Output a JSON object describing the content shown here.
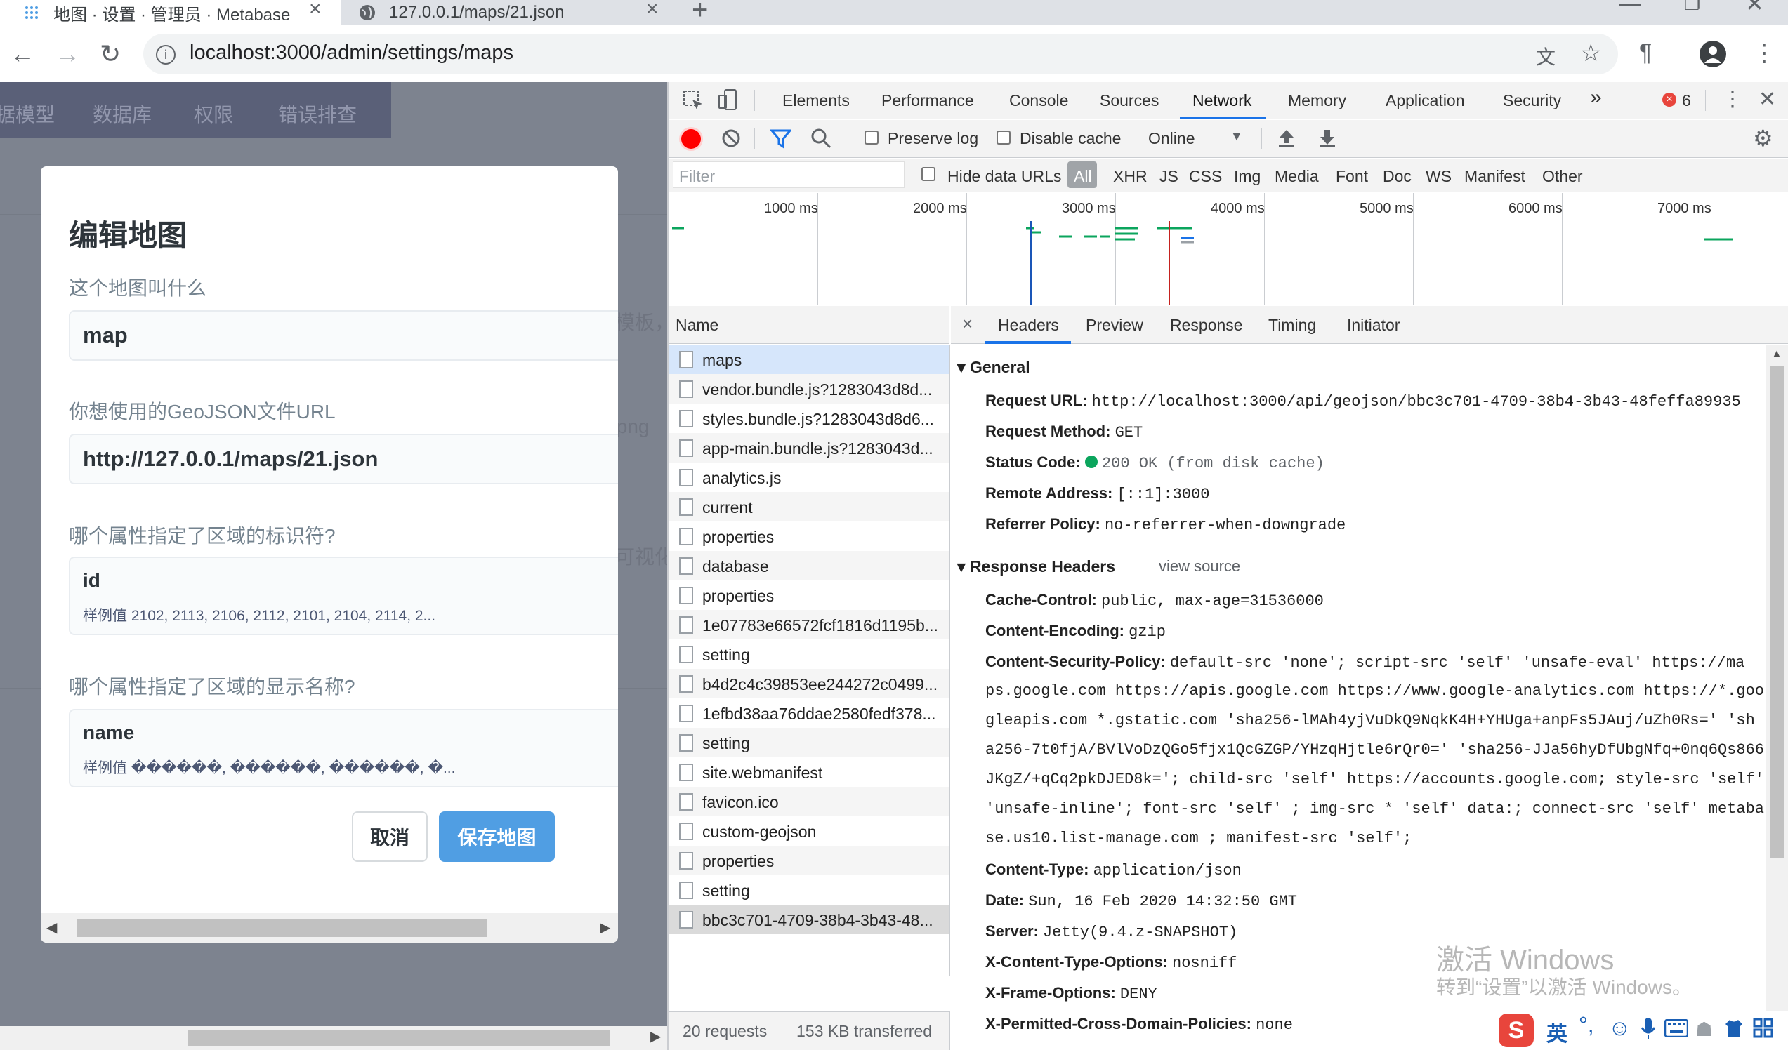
{
  "browser": {
    "tabs": [
      {
        "title": "地图 · 设置 · 管理员 · Metabase",
        "icon": "metabase-icon",
        "active": true
      },
      {
        "title": "127.0.0.1/maps/21.json",
        "icon": "globe-icon",
        "active": false
      }
    ],
    "new_tab": "+",
    "url": "localhost:3000/admin/settings/maps"
  },
  "page": {
    "nav": [
      "据模型",
      "数据库",
      "权限",
      "错误排查"
    ],
    "bg_fragments": [
      "模板，",
      ".png",
      "可视化"
    ]
  },
  "modal": {
    "title": "编辑地图",
    "name_label": "这个地图叫什么",
    "name_value": "map",
    "url_label": "你想使用的GeoJSON文件URL",
    "url_value": "http://127.0.0.1/maps/21.json",
    "region_id_label": "哪个属性指定了区域的标识符?",
    "region_id_value": "id",
    "region_id_sample": "样例值 2102, 2113, 2106, 2112, 2101, 2104, 2114, 2...",
    "region_name_label": "哪个属性指定了区域的显示名称?",
    "region_name_value": "name",
    "region_name_sample": "样例值 ������, ������, ������, �...",
    "cancel": "取消",
    "save": "保存地图"
  },
  "devtools": {
    "tabs": [
      "Elements",
      "Performance",
      "Console",
      "Sources",
      "Network",
      "Memory",
      "Application",
      "Security"
    ],
    "more": "»",
    "error_count": "6",
    "preserve_log": "Preserve log",
    "disable_cache": "Disable cache",
    "throttle": "Online",
    "filter_placeholder": "Filter",
    "hide_data_urls": "Hide data URLs",
    "filter_types": [
      "All",
      "XHR",
      "JS",
      "CSS",
      "Img",
      "Media",
      "Font",
      "Doc",
      "WS",
      "Manifest",
      "Other"
    ],
    "timeline_ticks": [
      "1000 ms",
      "2000 ms",
      "3000 ms",
      "4000 ms",
      "5000 ms",
      "6000 ms",
      "7000 ms"
    ],
    "name_header": "Name",
    "requests": [
      "maps",
      "vendor.bundle.js?1283043d8d...",
      "styles.bundle.js?1283043d8d6...",
      "app-main.bundle.js?1283043d...",
      "analytics.js",
      "current",
      "properties",
      "database",
      "properties",
      "1e07783e66572fcf1816d1195b...",
      "setting",
      "b4d2c4c39853ee244272c0499...",
      "1efbd38aa76ddae2580fedf378...",
      "setting",
      "site.webmanifest",
      "favicon.ico",
      "custom-geojson",
      "properties",
      "setting",
      "bbc3c701-4709-38b4-3b43-48..."
    ],
    "status_requests": "20 requests",
    "status_transferred": "153 KB transferred",
    "detail_tabs": [
      "Headers",
      "Preview",
      "Response",
      "Timing",
      "Initiator"
    ],
    "general_title": "General",
    "general": [
      {
        "k": "Request URL:",
        "v": "http://localhost:3000/api/geojson/bbc3c701-4709-38b4-3b43-48feffa89935"
      },
      {
        "k": "Request Method:",
        "v": "GET"
      },
      {
        "k": "Status Code:",
        "v": "200 OK (from disk cache)"
      },
      {
        "k": "Remote Address:",
        "v": "[::1]:3000"
      },
      {
        "k": "Referrer Policy:",
        "v": "no-referrer-when-downgrade"
      }
    ],
    "response_title": "Response Headers",
    "view_source": "view source",
    "cache_control": {
      "k": "Cache-Control:",
      "v": "public, max-age=31536000"
    },
    "content_encoding": {
      "k": "Content-Encoding:",
      "v": "gzip"
    },
    "csp_key": "Content-Security-Policy:",
    "csp_lines": [
      "default-src 'none'; script-src 'self' 'unsafe-eval' https://ma",
      "ps.google.com https://apis.google.com https://www.google-analytics.com https://*.goo",
      "gleapis.com *.gstatic.com  'sha256-lMAh4yjVuDkQ9NqkK4H+YHUga+anpFs5JAuj/uZh0Rs=' 'sh",
      "a256-7t0fjA/BVlVoDzQGo5fjx1QcGZGP/YHzqHjtle6rQr0=' 'sha256-JJa56hyDfUbgNfq+0nq6Qs866",
      "JKgZ/+qCq2pkDJED8k='; child-src 'self' https://accounts.google.com; style-src 'self'",
      "'unsafe-inline'; font-src 'self' ; img-src * 'self' data:; connect-src 'self' metaba",
      "se.us10.list-manage.com ; manifest-src 'self';"
    ],
    "more_headers": [
      {
        "k": "Content-Type:",
        "v": "application/json"
      },
      {
        "k": "Date:",
        "v": "Sun, 16 Feb 2020 14:32:50 GMT"
      },
      {
        "k": "Server:",
        "v": "Jetty(9.4.z-SNAPSHOT)"
      },
      {
        "k": "X-Content-Type-Options:",
        "v": "nosniff"
      },
      {
        "k": "X-Frame-Options:",
        "v": "DENY"
      },
      {
        "k": "X-Permitted-Cross-Domain-Policies:",
        "v": "none"
      }
    ]
  },
  "os": {
    "watermark_title": "激活 Windows",
    "watermark_sub": "转到“设置”以激活 Windows。",
    "ime_label": "英"
  },
  "colors": {
    "accent": "#509ee3",
    "devtools_blue": "#1a73e8",
    "record_red": "#ff0000",
    "metabase_nav": "#5a6078"
  }
}
